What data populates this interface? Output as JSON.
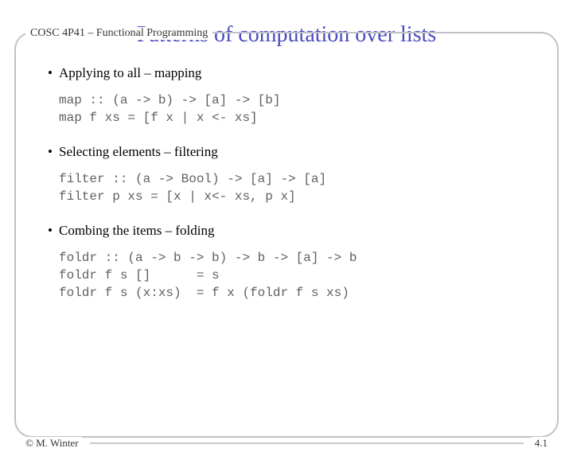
{
  "header": {
    "course": "COSC 4P41 – Functional Programming"
  },
  "title": "Patterns of computation over lists",
  "sections": [
    {
      "heading": "Applying to all – mapping",
      "code": "map :: (a -> b) -> [a] -> [b]\nmap f xs = [f x | x <- xs]"
    },
    {
      "heading": "Selecting elements – filtering",
      "code": "filter :: (a -> Bool) -> [a] -> [a]\nfilter p xs = [x | x<- xs, p x]"
    },
    {
      "heading": "Combing the items – folding",
      "code": "foldr :: (a -> b -> b) -> b -> [a] -> b\nfoldr f s []      = s\nfoldr f s (x:xs)  = f x (foldr f s xs)"
    }
  ],
  "footer": {
    "author": "© M. Winter",
    "page": "4.1"
  }
}
